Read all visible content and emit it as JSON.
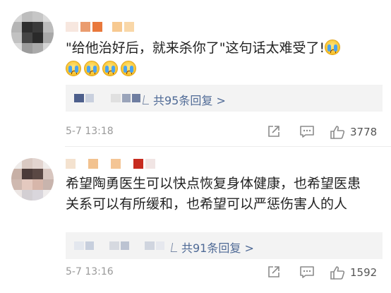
{
  "comments": [
    {
      "id": "c1",
      "username_hidden": true,
      "text": "\"给他治好后，就来杀你了\"这句话太难受了!",
      "emoji": [
        "cry-emoji",
        "cry-emoji",
        "cry-emoji",
        "cry-emoji",
        "cry-emoji"
      ],
      "reply_label": "共95条回复 >",
      "time": "5-7 13:18",
      "likes": "3778"
    },
    {
      "id": "c2",
      "username_hidden": true,
      "text_line1": "希望陶勇医生可以快点恢复身体健康，也希望医患",
      "text_line2": "关系可以有所缓和，也希望可以严惩伤害人的人",
      "reply_label": "共91条回复 >",
      "time": "5-7 13:16",
      "likes": "1592"
    }
  ],
  "colors": {
    "link": "#4f6a96",
    "meta": "#999999",
    "reply_bg": "#f3f3f3"
  },
  "icons": [
    "share-icon",
    "comment-icon",
    "like-icon",
    "reply-corner-icon"
  ]
}
